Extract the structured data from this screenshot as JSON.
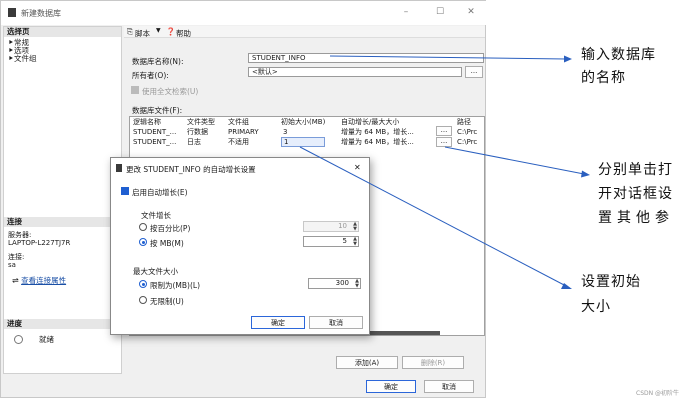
{
  "window": {
    "title": "新建数据库",
    "controls": [
      "–",
      "☐",
      "✕"
    ]
  },
  "left": {
    "select_page_title": "选择页",
    "pages": [
      "常规",
      "选项",
      "文件组"
    ],
    "connection_title": "连接",
    "server_label": "服务器:",
    "server_value": "LAPTOP-L227TJ7R",
    "connection_label": "连接:",
    "connection_value": "sa",
    "view_props_link": "查看连接属性",
    "progress_title": "进度",
    "progress_status": "就绪"
  },
  "toolbar": {
    "script_label": "脚本",
    "help_label": "帮助"
  },
  "form": {
    "dbname_label": "数据库名称(N):",
    "dbname_value": "STUDENT_INFO",
    "owner_label": "所有者(O):",
    "owner_value": "<默认>",
    "owner_browse": "...",
    "fulltext_label": "使用全文检索(U)",
    "files_label": "数据库文件(F):"
  },
  "file_table": {
    "headers": [
      "逻辑名称",
      "文件类型",
      "文件组",
      "初始大小(MB)",
      "自动增长/最大大小",
      "路径"
    ],
    "rows": [
      [
        "STUDENT_...",
        "行数据",
        "PRIMARY",
        "3",
        "增量为 64 MB，增长...",
        "C:\\Prc"
      ],
      [
        "STUDENT_...",
        "日志",
        "不适用",
        "1",
        "增量为 64 MB，增长...",
        "C:\\Prc"
      ]
    ],
    "browse": "..."
  },
  "bottom": {
    "add_button": "添加(A)",
    "remove_button": "删除(R)",
    "ok_button": "确定",
    "cancel_button": "取消"
  },
  "dialog": {
    "title": "更改 STUDENT_INFO 的自动增长设置",
    "close": "✕",
    "enable_autogrowth": "启用自动增长(E)",
    "file_growth_label": "文件增长",
    "percent_option": "按百分比(P)",
    "percent_value": "10",
    "mb_option": "按 MB(M)",
    "mb_value": "5",
    "max_size_label": "最大文件大小",
    "limited_option": "限制为(MB)(L)",
    "limited_value": "300",
    "unlimited_option": "无限制(U)",
    "ok_button": "确定",
    "cancel_button": "取消"
  },
  "annotations": {
    "a1_line1": "输入数据库",
    "a1_line2": "的名称",
    "a2_line1": "分别单击打",
    "a2_line2": "开对话框设",
    "a2_line3": "置其他参",
    "a3_line1": "设置初始",
    "a3_line2": "大小"
  },
  "watermark": "CSDN @初阶牛",
  "colors": {
    "accent": "#1f5fd1",
    "arrow": "#2a5fbf"
  }
}
